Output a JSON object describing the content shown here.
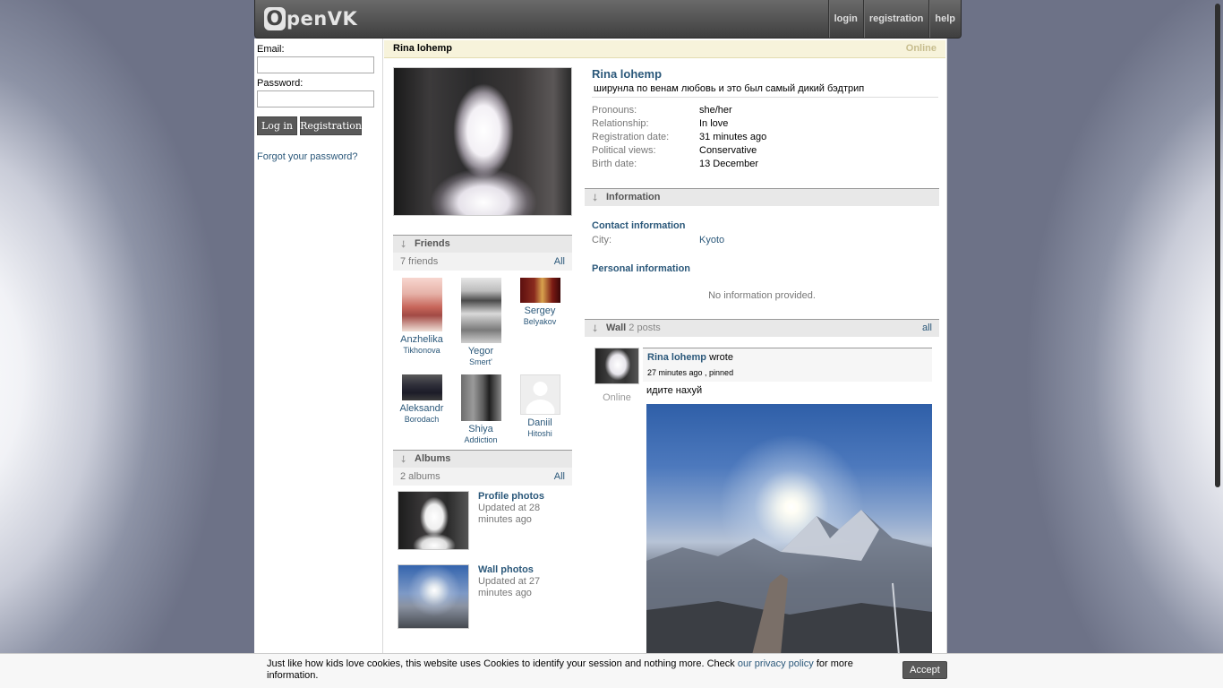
{
  "header": {
    "logo_text": "penVK",
    "logo_letter": "O",
    "nav": [
      "login",
      "registration",
      "help"
    ]
  },
  "login": {
    "email_label": "Email:",
    "password_label": "Password:",
    "login_button": "Log in",
    "register_button": "Registration",
    "forgot": "Forgot your password?"
  },
  "profile": {
    "title_name": "Rina lohemp",
    "online_status": "Online",
    "name": "Rina lohemp",
    "status": "ширунла по венам любовь и это был самый дикий бэдтрип",
    "fields": [
      {
        "k": "Pronouns:",
        "v": "she/her"
      },
      {
        "k": "Relationship:",
        "v": "In love"
      },
      {
        "k": "Registration date:",
        "v": "31 minutes ago"
      },
      {
        "k": "Political views:",
        "v": "Conservative"
      },
      {
        "k": "Birth date:",
        "v": "13 December"
      }
    ]
  },
  "friends": {
    "title": "Friends",
    "count": "7 friends",
    "all": "All",
    "items": [
      {
        "first": "Anzhelika",
        "last": "Tikhonova"
      },
      {
        "first": "Yegor",
        "last": "Smert'"
      },
      {
        "first": "Sergey",
        "last": "Belyakov"
      },
      {
        "first": "Aleksandr",
        "last": "Borodach"
      },
      {
        "first": "Shiya",
        "last": "Addiction"
      },
      {
        "first": "Daniil",
        "last": "Hitoshi"
      }
    ]
  },
  "albums": {
    "title": "Albums",
    "count": "2 albums",
    "all": "All",
    "items": [
      {
        "title": "Profile photos",
        "desc": "Updated at 28 minutes ago"
      },
      {
        "title": "Wall photos",
        "desc": "Updated at 27 minutes ago"
      }
    ]
  },
  "information": {
    "title": "Information",
    "contact_title": "Contact information",
    "city_label": "City:",
    "city_value": "Kyoto",
    "personal_title": "Personal information",
    "no_info": "No information provided."
  },
  "wall": {
    "title": "Wall",
    "count": "2 posts",
    "all": "all",
    "post": {
      "author": "Rina lohemp",
      "wrote": "wrote",
      "meta": "27 minutes ago , pinned",
      "online": "Online",
      "text": "идите нахуй"
    }
  },
  "cookie": {
    "text_before": "Just like how kids love cookies, this website uses Cookies to identify your session and nothing more. Check ",
    "link": "our privacy policy",
    "text_after": " for more information.",
    "accept": "Accept"
  }
}
